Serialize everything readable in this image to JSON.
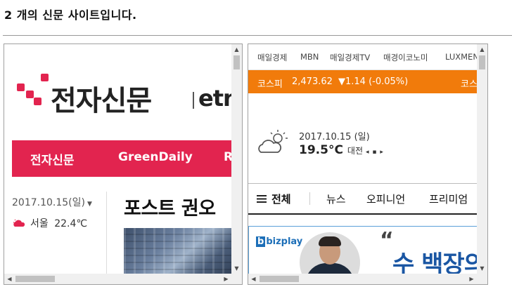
{
  "page": {
    "heading": "2 개의 신문 사이트입니다."
  },
  "site_a": {
    "logo_text": "전자신문",
    "logo_en": "etn",
    "nav": [
      "전자신문",
      "GreenDaily",
      "R"
    ],
    "date": "2017.10.15(일)",
    "weather_city": "서울",
    "weather_temp": "22.4℃",
    "headline": "포스트 권오",
    "colors": {
      "brand": "#e2244f"
    }
  },
  "site_b": {
    "top_nav": [
      "매일경제",
      "MBN",
      "매일경제TV",
      "매경이코노미",
      "LUXMEN"
    ],
    "ticker": {
      "label": "코스피",
      "value": "2,473.62",
      "change": "▼1.14 (-0.05%)",
      "label2": "코스"
    },
    "date": "2017.10.15 (일)",
    "temp": "19.5°C",
    "city": "대전",
    "nav": [
      "전체",
      "뉴스",
      "오피니언",
      "프리미엄"
    ],
    "ad": {
      "brand": "bizplay",
      "text": "수 백장의"
    },
    "colors": {
      "ticker": "#f17b0b",
      "ad": "#1a56a3"
    }
  }
}
